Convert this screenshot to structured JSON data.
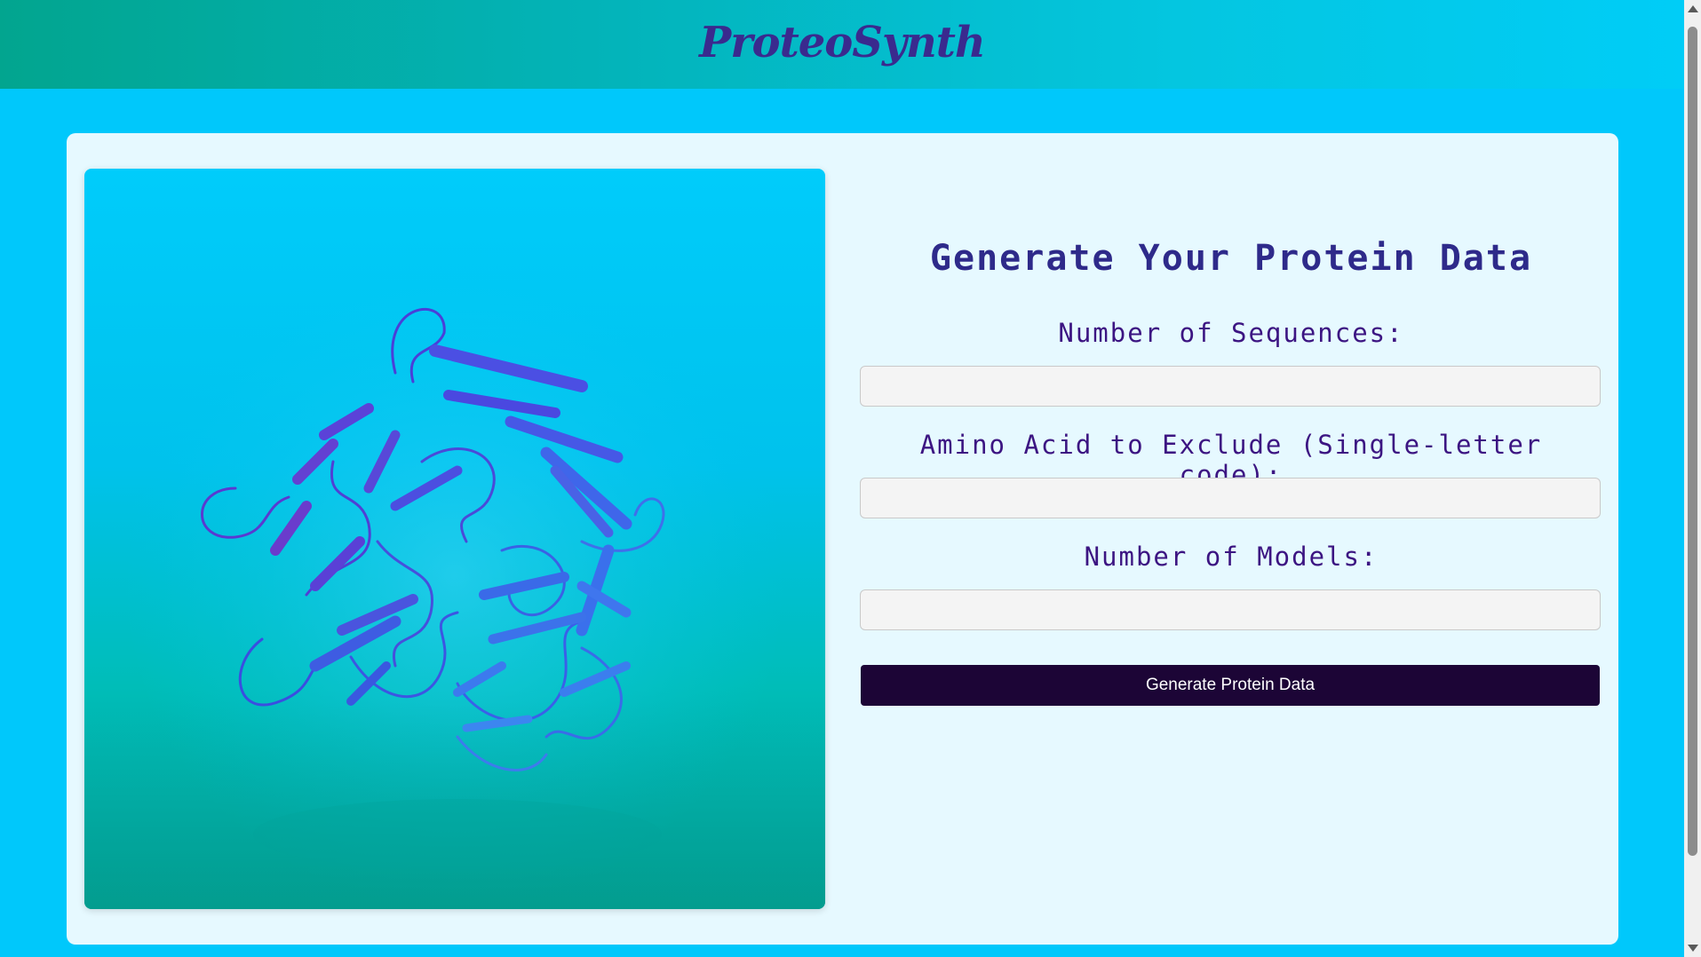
{
  "header": {
    "brand": "ProteoSynth"
  },
  "colors": {
    "page_background": "#00c8fb",
    "card_background": "#e6f9ff",
    "title_color": "#2e2a8a",
    "label_color": "#3c1582",
    "button_background": "#1c0536"
  },
  "image_panel": {
    "icon": "protein-structure-illustration"
  },
  "form": {
    "title": "Generate Your Protein Data",
    "fields": [
      {
        "label": "Number of Sequences:",
        "value": "",
        "placeholder": ""
      },
      {
        "label": "Amino Acid to Exclude (Single-letter code):",
        "value": "",
        "placeholder": ""
      },
      {
        "label": "Number of Models:",
        "value": "",
        "placeholder": ""
      }
    ],
    "submit_label": "Generate Protein Data"
  }
}
